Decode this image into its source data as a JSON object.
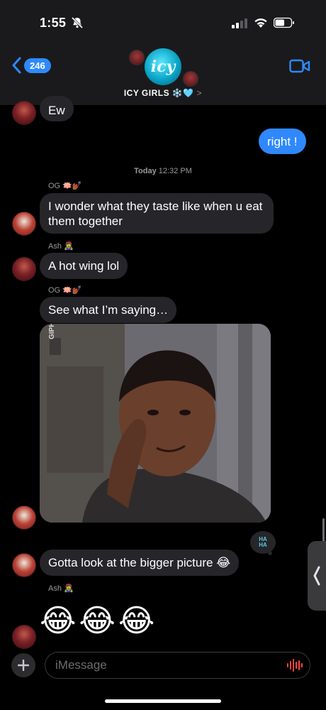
{
  "status_bar": {
    "time": "1:55",
    "battery_level": 0.6
  },
  "header": {
    "back_count": "246",
    "group_avatar_text": "icy",
    "group_name": "ICY GIRLS ❄️🩵",
    "group_chevron": ">"
  },
  "messages": [
    {
      "side": "received",
      "text": "Ew"
    },
    {
      "side": "sent",
      "text": "right !"
    },
    {
      "side": "received",
      "sender": "OG 🪷💅🏾",
      "text": "I wonder what they taste like when u eat them together"
    },
    {
      "side": "received",
      "sender": "Ash 🧟‍♀️",
      "text": "A hot wing lol"
    },
    {
      "side": "received",
      "sender": "OG 🪷💅🏾",
      "text": "See what I’m saying…"
    },
    {
      "side": "received",
      "type": "image",
      "image_text": "GIPHY"
    },
    {
      "side": "received",
      "text": "Gotta look at the bigger picture 😂",
      "tapback": "HA HA"
    },
    {
      "side": "received",
      "sender": "Ash 🧟‍♀️",
      "text": "😂😂😂"
    }
  ],
  "timestamp": {
    "day": "Today",
    "time": "12:32 PM"
  },
  "compose": {
    "placeholder": "iMessage"
  },
  "colors": {
    "sent_bubble": "#2f89fc",
    "received_bubble": "#26252a",
    "accent": "#2f89fc",
    "audio": "#ff453a"
  }
}
